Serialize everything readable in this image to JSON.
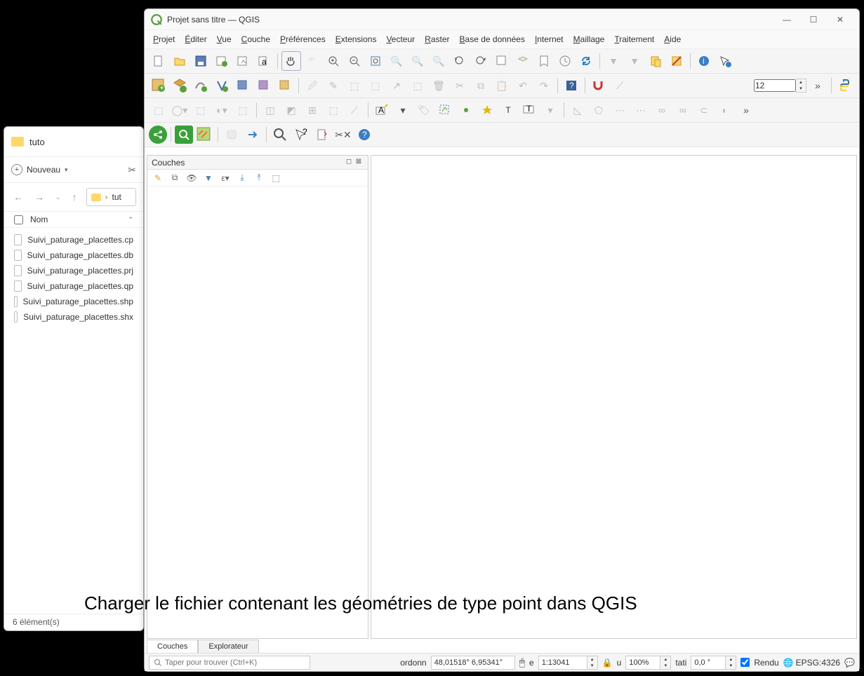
{
  "explorer": {
    "title": "tuto",
    "new_button": "Nouveau",
    "path": "tut",
    "columns": {
      "name": "Nom"
    },
    "files": [
      "Suivi_paturage_placettes.cp",
      "Suivi_paturage_placettes.db",
      "Suivi_paturage_placettes.prj",
      "Suivi_paturage_placettes.qp",
      "Suivi_paturage_placettes.shp",
      "Suivi_paturage_placettes.shx"
    ],
    "status": "6 élément(s)"
  },
  "qgis": {
    "title": "Projet sans titre — QGIS",
    "menu": [
      "Projet",
      "Éditer",
      "Vue",
      "Couche",
      "Préférences",
      "Extensions",
      "Vecteur",
      "Raster",
      "Base de données",
      "Internet",
      "Maillage",
      "Traitement",
      "Aide"
    ],
    "layers_title": "Couches",
    "tabs": {
      "layers": "Couches",
      "browser": "Explorateur"
    },
    "segments_value": "12",
    "search_placeholder": "Taper pour trouver (Ctrl+K)",
    "status": {
      "coord_label": "ordonn",
      "coord_value": "48,01518° 6,95341°",
      "scale_label": "e",
      "scale_value": "1:13041",
      "mag_label": "u",
      "mag_value": "100%",
      "rot_label": "tati",
      "rot_value": "0,0 °",
      "render": "Rendu",
      "crs": "EPSG:4326"
    }
  },
  "caption": "Charger le fichier contenant les géométries de type point dans QGIS"
}
